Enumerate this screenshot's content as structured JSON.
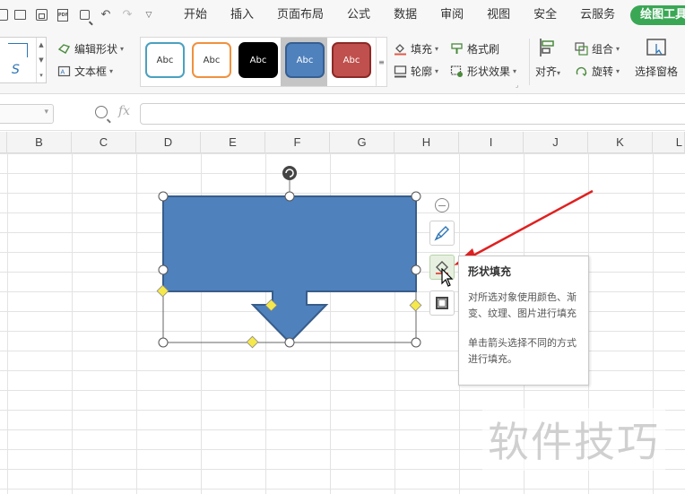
{
  "menubar": {
    "tabs": [
      {
        "label": "开始"
      },
      {
        "label": "插入"
      },
      {
        "label": "页面布局"
      },
      {
        "label": "公式"
      },
      {
        "label": "数据"
      },
      {
        "label": "审阅"
      },
      {
        "label": "视图"
      },
      {
        "label": "安全"
      },
      {
        "label": "云服务"
      }
    ],
    "active_tab": "绘图工具",
    "active_color": "#3aa755"
  },
  "ribbon": {
    "edit_shape": "编辑形状",
    "text_box": "文本框",
    "styles": [
      {
        "label": "Abc",
        "border": "#4ba0c0",
        "fill": "#ffffff",
        "text": "#333333"
      },
      {
        "label": "Abc",
        "border": "#f0913e",
        "fill": "#ffffff",
        "text": "#333333"
      },
      {
        "label": "Abc",
        "border": "#000000",
        "fill": "#000000",
        "text": "#ffffff"
      },
      {
        "label": "Abc",
        "border": "#365f91",
        "fill": "#4f81bd",
        "text": "#ffffff"
      },
      {
        "label": "Abc",
        "border": "#8b2a28",
        "fill": "#c0504d",
        "text": "#ffffff"
      }
    ],
    "fill": "填充",
    "format_painter": "格式刷",
    "outline": "轮廓",
    "shape_effects": "形状效果",
    "align": "对齐",
    "group": "组合",
    "rotate": "旋转",
    "selection_pane": "选择窗格"
  },
  "formula_bar": {
    "fx": "fx"
  },
  "columns": [
    "B",
    "C",
    "D",
    "E",
    "F",
    "G",
    "H",
    "I",
    "J",
    "K",
    "L"
  ],
  "shape": {
    "fill": "#4f81bd",
    "stroke": "#385d8a"
  },
  "tooltip": {
    "title": "形状填充",
    "body": "对所选对象使用颜色、渐变、纹理、图片进行填充",
    "hint": "单击箭头选择不同的方式进行填充。"
  },
  "watermark": "软件技巧"
}
